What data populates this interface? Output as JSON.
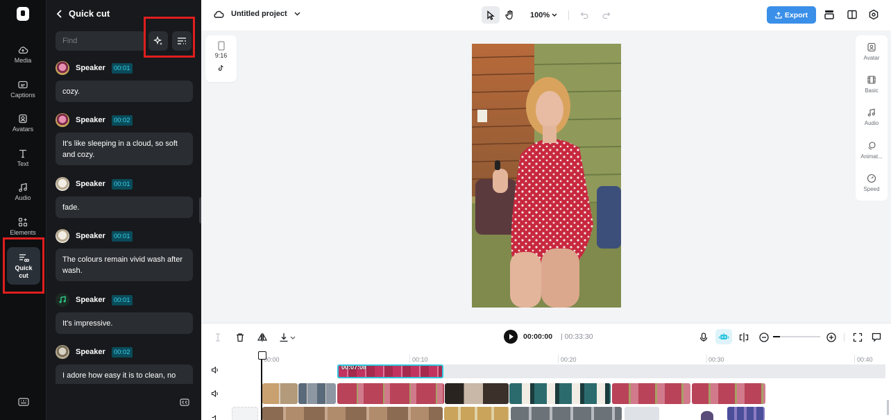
{
  "rail": {
    "items": [
      {
        "label": "Media"
      },
      {
        "label": "Captions"
      },
      {
        "label": "Avatars"
      },
      {
        "label": "Text"
      },
      {
        "label": "Audio"
      },
      {
        "label": "Elements"
      },
      {
        "label": "Quick\ncut"
      }
    ]
  },
  "panel": {
    "title": "Quick cut",
    "search_placeholder": "Find",
    "entries": [
      {
        "speaker": "Speaker",
        "time": "00:01",
        "text": "cozy.",
        "avatar_color": "#c45a8a"
      },
      {
        "speaker": "Speaker",
        "time": "00:02",
        "text": "It's like sleeping in a cloud, so soft and cozy.",
        "avatar_color": "#c45a8a"
      },
      {
        "speaker": "Speaker",
        "time": "00:01",
        "text": "fade.",
        "avatar_color": "#cfc6b6"
      },
      {
        "speaker": "Speaker",
        "time": "00:01",
        "text": "The colours remain vivid wash after wash.",
        "avatar_color": "#cfc6b6"
      },
      {
        "speaker": "Speaker",
        "time": "00:01",
        "text": "It's impressive.",
        "avatar_color": "#1f7a55"
      },
      {
        "speaker": "Speaker",
        "time": "00:02",
        "text": "I adore how easy it is to clean, no",
        "avatar_color": "#b7ad96"
      }
    ]
  },
  "topbar": {
    "project_name": "Untitled project",
    "zoom": "100%",
    "export_label": "Export"
  },
  "canvas": {
    "ratio": "9:16"
  },
  "right_tools": [
    {
      "label": "Avatar"
    },
    {
      "label": "Basic"
    },
    {
      "label": "Audio"
    },
    {
      "label": "Animat..."
    },
    {
      "label": "Speed"
    }
  ],
  "timeline": {
    "current_time": "00:00:00",
    "separator": "|",
    "total_time": "00:33:30",
    "ruler": [
      "00:00",
      "00:10",
      "00:20",
      "00:30",
      "00:40"
    ],
    "caption_clip_label": "00:07:08"
  },
  "colors": {
    "accent": "#3a8fe8",
    "timecode_bg": "#0a4b5a",
    "timecode_fg": "#38d0e8",
    "highlight_box": "#e01e1e"
  }
}
